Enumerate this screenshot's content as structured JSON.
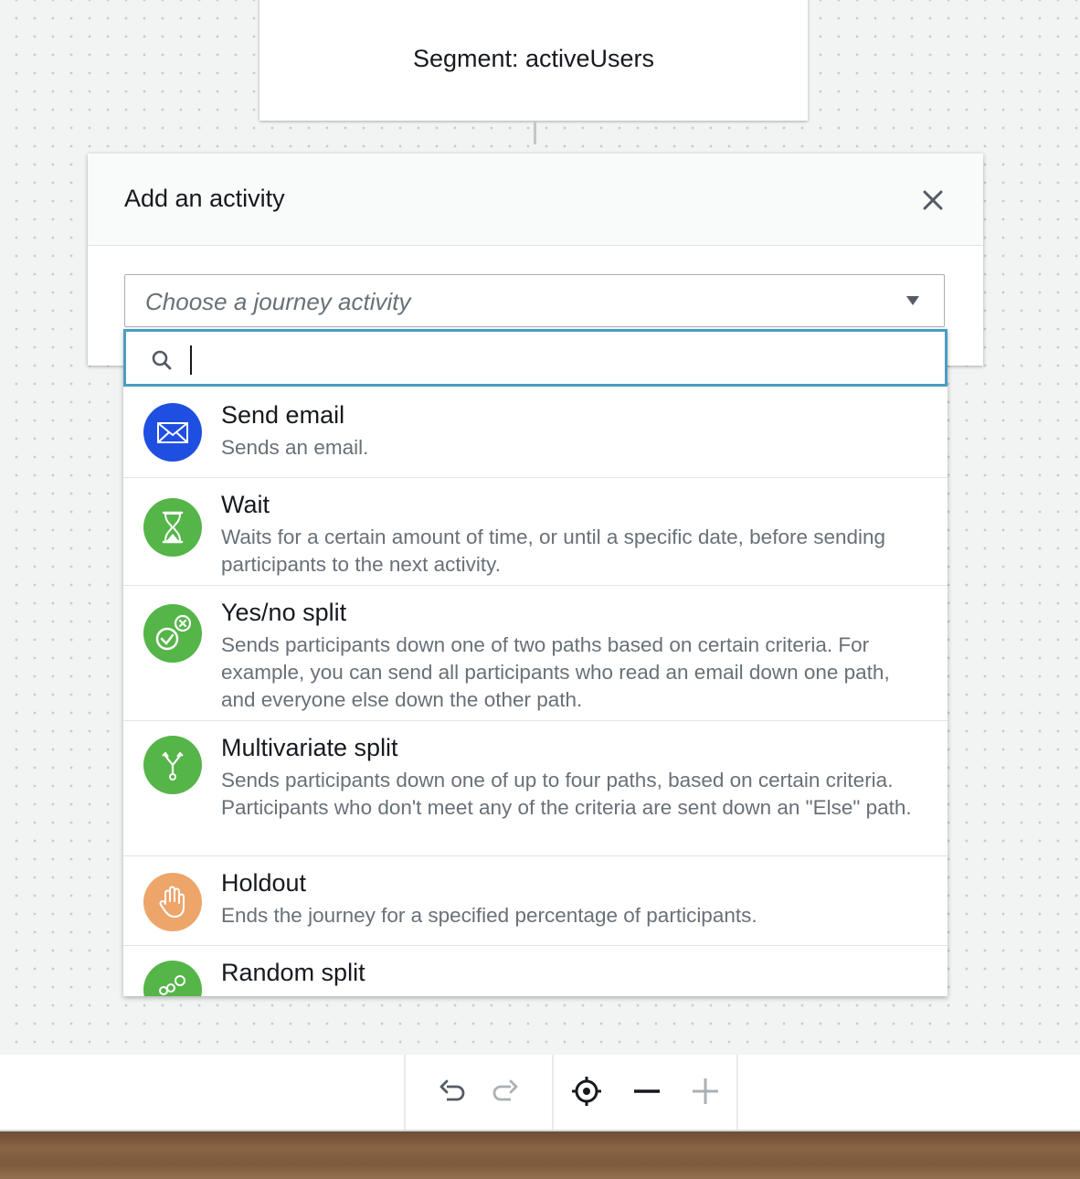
{
  "segment_node": {
    "label": "Segment: activeUsers"
  },
  "modal": {
    "title": "Add an activity",
    "close_icon": "close-icon",
    "select": {
      "placeholder": "Choose a journey activity",
      "caret_icon": "caret-down-icon"
    },
    "search": {
      "icon": "search-icon",
      "value": ""
    },
    "options": [
      {
        "title": "Send email",
        "description": "Sends an email.",
        "icon": "envelope-icon",
        "color": "#1f4fe0"
      },
      {
        "title": "Wait",
        "description": "Waits for a certain amount of time, or until a specific date, before sending participants to the next activity.",
        "icon": "hourglass-icon",
        "color": "#55b548"
      },
      {
        "title": "Yes/no split",
        "description": "Sends participants down one of two paths based on certain criteria. For example, you can send all participants who read an email down one path, and everyone else down the other path.",
        "icon": "yes-no-icon",
        "color": "#55b548"
      },
      {
        "title": "Multivariate split",
        "description": "Sends participants down one of up to four paths, based on certain criteria. Participants who don't meet any of the criteria are sent down an \"Else\" path.",
        "icon": "fork-icon",
        "color": "#55b548"
      },
      {
        "title": "Holdout",
        "description": "Ends the journey for a specified percentage of participants.",
        "icon": "hand-icon",
        "color": "#eea56a"
      },
      {
        "title": "Random split",
        "description": "",
        "icon": "random-split-icon",
        "color": "#55b548"
      }
    ]
  },
  "toolbar": {
    "undo_icon": "undo-icon",
    "redo_icon": "redo-icon",
    "center_icon": "recenter-icon",
    "zoom_out_icon": "zoom-out-icon",
    "zoom_in_icon": "zoom-in-icon"
  }
}
